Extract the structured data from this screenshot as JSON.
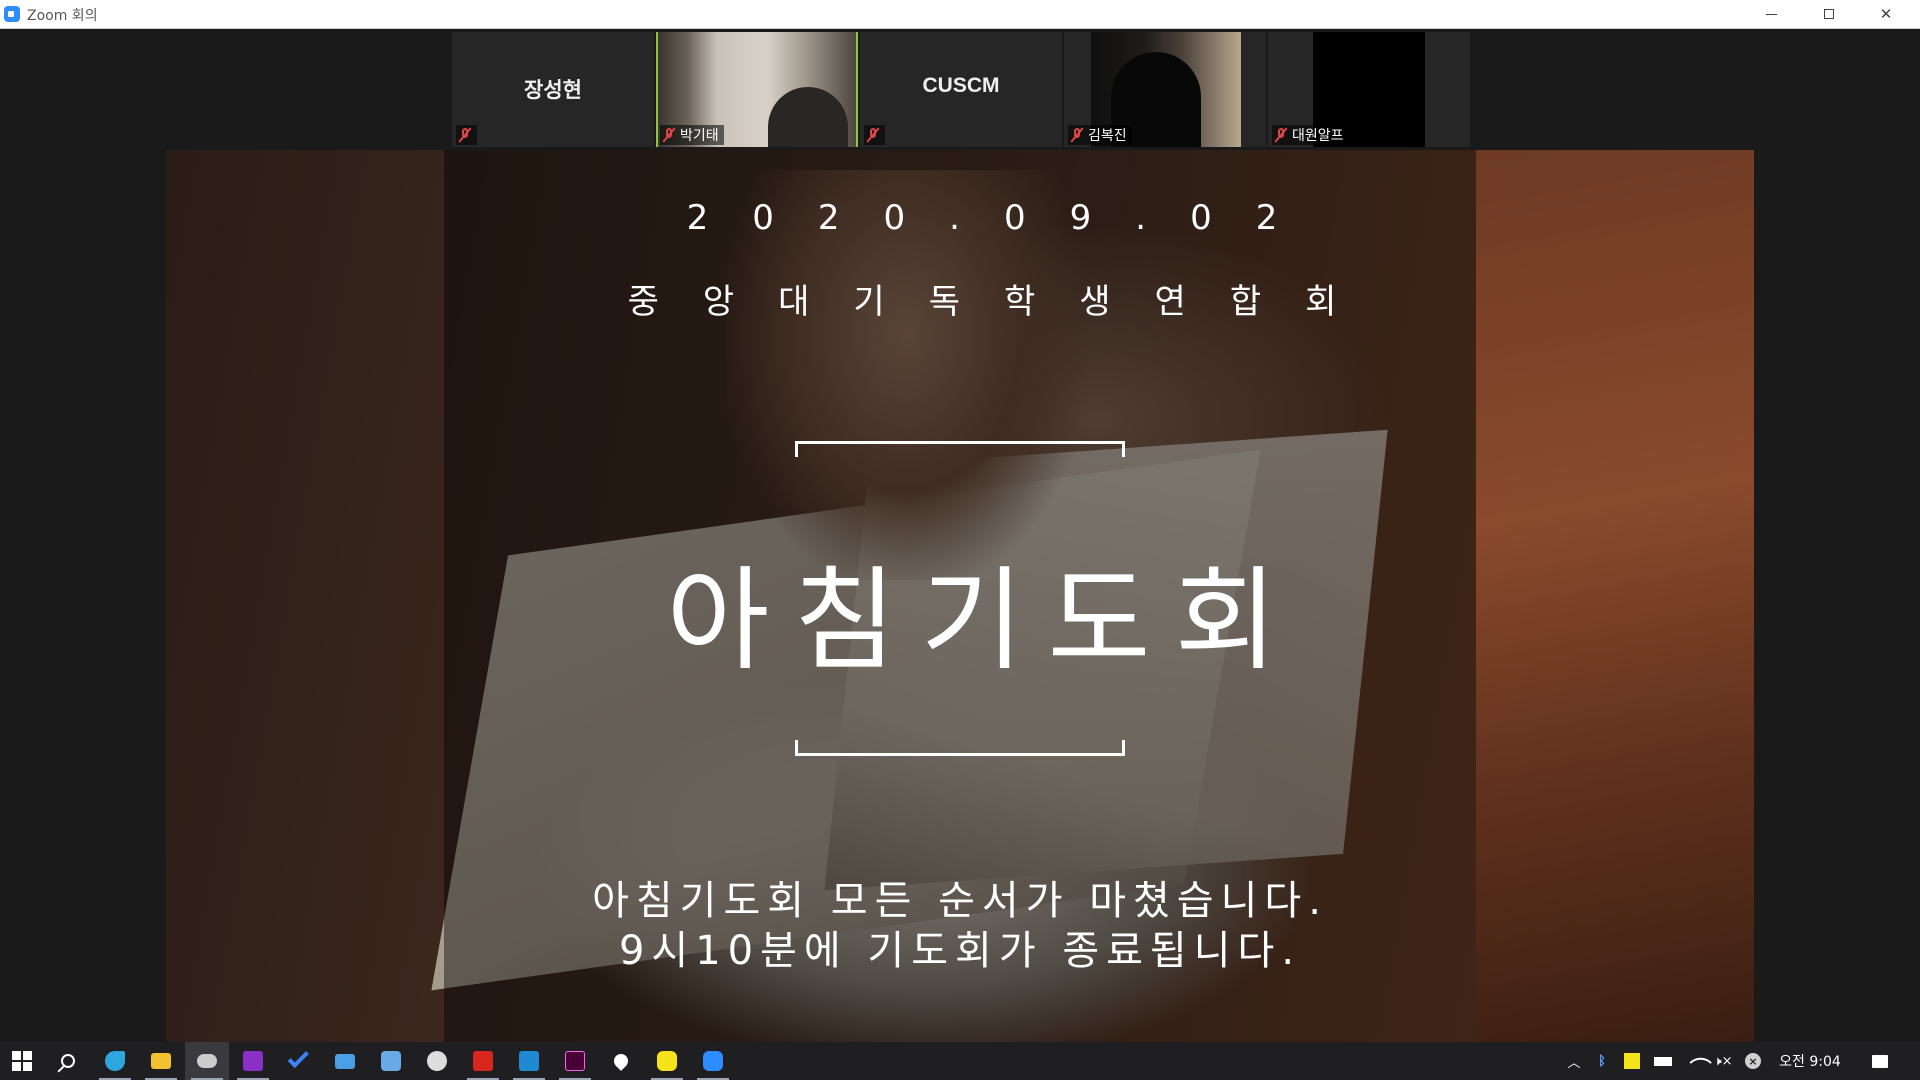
{
  "window": {
    "title": "Zoom 회의"
  },
  "participants": [
    {
      "name": "장성현",
      "video": false,
      "muted": true
    },
    {
      "name": "박기태",
      "video": true,
      "muted": true,
      "active": true
    },
    {
      "name": "CUSCM",
      "video": false,
      "muted": true
    },
    {
      "name": "김복진",
      "video": true,
      "muted": true
    },
    {
      "name": "대원알프",
      "video": true,
      "muted": true
    }
  ],
  "slide": {
    "date": "2020.09.02",
    "organization": "중앙대기독학생연합회",
    "title": "아침기도회",
    "line1": "아침기도회 모든 순서가 마쳤습니다.",
    "line2": "9시10분에 기도회가 종료됩니다."
  },
  "taskbar": {
    "apps": [
      {
        "name": "start",
        "icon": "windows-logo-icon"
      },
      {
        "name": "search",
        "icon": "search-icon"
      },
      {
        "name": "app-blue-bird",
        "icon": "bird-icon",
        "color": "#2ea7e0",
        "running": true
      },
      {
        "name": "file-explorer",
        "icon": "folder-icon",
        "color": "#f2c230",
        "running": true
      },
      {
        "name": "app-cloud",
        "icon": "cloud-icon",
        "color": "#cccccc",
        "running": true,
        "focused": true
      },
      {
        "name": "onenote",
        "icon": "onenote-icon",
        "color": "#8b2fc9",
        "running": true
      },
      {
        "name": "todo",
        "icon": "check-icon",
        "color": "#3b82f6"
      },
      {
        "name": "remote-desktop",
        "icon": "monitor-icon",
        "color": "#4aa0e6"
      },
      {
        "name": "network-app",
        "icon": "network-icon",
        "color": "#6aa9e8"
      },
      {
        "name": "app-shield",
        "icon": "shield-icon",
        "color": "#dddddd"
      },
      {
        "name": "acrobat",
        "icon": "pdf-icon",
        "color": "#d7261e",
        "running": true
      },
      {
        "name": "vscode",
        "icon": "vscode-icon",
        "color": "#1f8ad2",
        "running": true
      },
      {
        "name": "adobe-xd",
        "icon": "xd-icon",
        "color": "#470137",
        "running": true
      },
      {
        "name": "app-drop",
        "icon": "drop-icon",
        "color": "#ffffff"
      },
      {
        "name": "kakaotalk",
        "icon": "chat-bubble-icon",
        "color": "#f7e31a",
        "running": true
      },
      {
        "name": "zoom",
        "icon": "zoom-icon",
        "color": "#2d8cff",
        "running": true
      }
    ],
    "tray": {
      "clock": "오전 9:04"
    }
  },
  "colors": {
    "muted_red": "#e04545",
    "active_border": "#8cc63f",
    "zoom_blue": "#2d8cff"
  }
}
